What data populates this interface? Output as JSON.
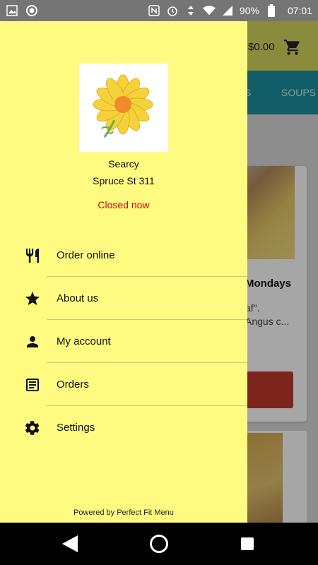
{
  "status_bar": {
    "battery": "90%",
    "time": "07:01",
    "left_icons": [
      "image-icon",
      "circle-icon"
    ],
    "right_icons": [
      "nfc-icon",
      "alarm-icon",
      "data-arrows-icon",
      "wifi-icon",
      "signal-icon",
      "battery-icon"
    ]
  },
  "app": {
    "cart_total": "$0.00",
    "tabs": [
      "S",
      "SOUPS"
    ],
    "card": {
      "title": "Mondays",
      "desc_line1": "af\".",
      "desc_line2": "Angus c..."
    },
    "colors": {
      "header": "#d6d65e",
      "tabs": "#1a8f9e",
      "button": "#c0392b"
    }
  },
  "drawer": {
    "store_name": "Searcy",
    "store_address": "Spruce St 311",
    "store_status": "Closed now",
    "menu": [
      {
        "label": "Order online",
        "icon": "utensils-icon"
      },
      {
        "label": "About us",
        "icon": "star-icon"
      },
      {
        "label": "My account",
        "icon": "person-icon"
      },
      {
        "label": "Orders",
        "icon": "receipt-icon"
      },
      {
        "label": "Settings",
        "icon": "gear-icon"
      }
    ],
    "powered_by": "Powered by Perfect Fit Menu",
    "colors": {
      "background": "#fffb80",
      "status": "#e00000"
    }
  }
}
